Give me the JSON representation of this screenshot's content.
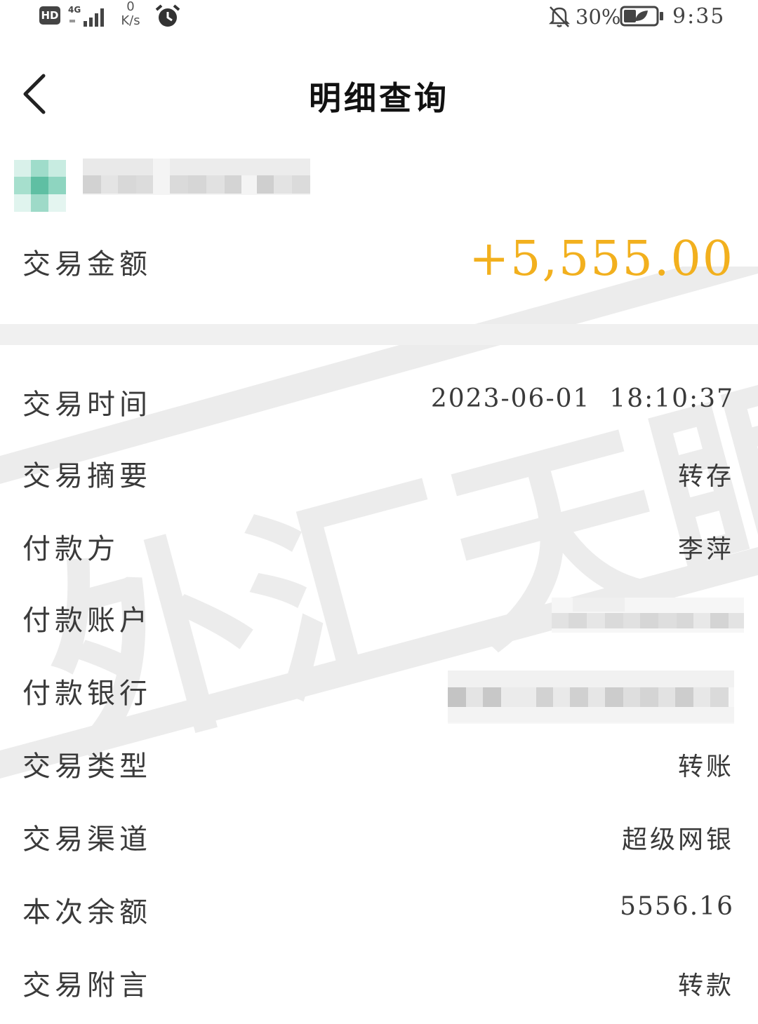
{
  "status_bar": {
    "hd": "HD",
    "network": "4G",
    "speed_value": "0",
    "speed_unit": "K/s",
    "battery": "30%",
    "time": "9:35",
    "icons": [
      "signal-icon",
      "alarm-icon",
      "mute-icon",
      "battery-icon"
    ]
  },
  "header": {
    "title": "明细查询",
    "back_icon": "chevron-left-icon"
  },
  "amount": {
    "label": "交易金额",
    "value": "+5,555.00",
    "color": "#f2b01e"
  },
  "details": [
    {
      "label": "交易时间",
      "value": "2023-06-01  18:10:37"
    },
    {
      "label": "交易摘要",
      "value": "转存"
    },
    {
      "label": "付款方",
      "value": "李萍"
    },
    {
      "label": "付款账户",
      "value": ""
    },
    {
      "label": "付款银行",
      "value": ""
    },
    {
      "label": "交易类型",
      "value": "转账"
    },
    {
      "label": "交易渠道",
      "value": "超级网银"
    },
    {
      "label": "本次余额",
      "value": "5556.16"
    },
    {
      "label": "交易附言",
      "value": "转款"
    }
  ],
  "watermark": "外汇天眼",
  "colors": {
    "accent": "#f2b01e",
    "text": "#3a3a3a",
    "divider": "#f0f0f0",
    "logo_teal": "#7ccfb8"
  }
}
